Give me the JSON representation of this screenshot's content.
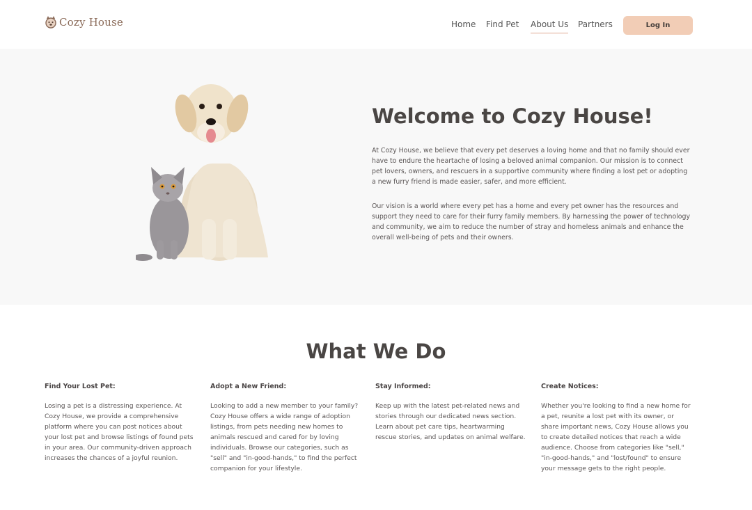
{
  "header": {
    "brand": "Cozy House",
    "nav": [
      "Home",
      "Find Pet",
      "About Us",
      "Partners"
    ],
    "active_nav": "About Us",
    "login_label": "Log In",
    "accent_color": "#f2cdb6"
  },
  "hero": {
    "title": "Welcome to Cozy House!",
    "p1": "At Cozy House, we believe that every pet deserves a loving home and that no family should ever have to endure the heartache of losing a beloved animal companion. Our mission is to connect pet lovers, owners, and rescuers in a supportive community where finding a lost pet or adopting a new furry friend is made easier, safer, and more efficient.",
    "p2": "Our vision is a world where every pet has a home and every pet owner has the resources and support they need to care for their furry family members. By harnessing the power of technology and community, we aim to reduce the number of stray and homeless animals and enhance the overall well-being of pets and their owners.",
    "image_icon": "dog-and-cat-illustration"
  },
  "what_we_do": {
    "title": "What We Do",
    "items": [
      {
        "title": "Find Your Lost Pet:",
        "text": "Losing a pet is a distressing experience. At Cozy House, we provide a comprehensive platform where you can post notices about your lost pet and browse listings of found pets in your area. Our community-driven approach increases the chances of a joyful reunion."
      },
      {
        "title": "Adopt a New Friend:",
        "text": "Looking to add a new member to your family? Cozy House offers a wide range of adoption listings, from pets needing new homes to animals rescued and cared for by loving individuals. Browse our categories, such as \"sell\" and \"in-good-hands,\" to find the perfect companion for your lifestyle."
      },
      {
        "title": "Stay Informed:",
        "text": "Keep up with the latest pet-related news and stories through our dedicated news section. Learn about pet care tips, heartwarming rescue stories, and updates on animal welfare."
      },
      {
        "title": "Create Notices:",
        "text": "Whether you're looking to find a new home for a pet, reunite a lost pet with its owner, or share important news, Cozy House allows you to create detailed notices that reach a wide audience. Choose from categories like \"sell,\" \"in-good-hands,\" and \"lost/found\" to ensure your message gets to the right people."
      }
    ]
  }
}
